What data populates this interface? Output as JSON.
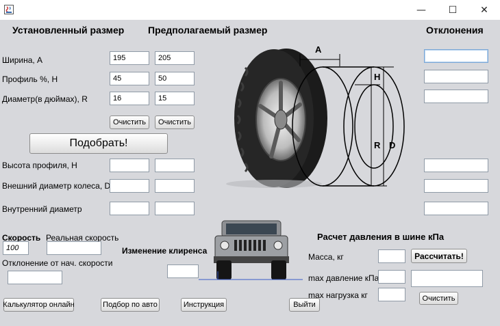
{
  "window": {
    "minimize_symbol": "—",
    "maximize_symbol": "☐",
    "close_symbol": "✕"
  },
  "headers": {
    "installed_size": "Установленный размер",
    "proposed_size": "Предполагаемый размер",
    "deviations": "Отклонения"
  },
  "labels": {
    "width": "Ширина,  А",
    "profile": "Профиль %, Н",
    "diameter": "Диаметр(в дюймах), R",
    "profile_height": "Высота профиля, Н",
    "outer_diameter": "Внешний диаметр колеса, D",
    "inner_diameter": "Внутренний диаметр",
    "speed": "Скорость",
    "real_speed": "Реальная скорость",
    "speed_deviation": "Отклонение от нач. скорости",
    "clearance_change": "Изменение клиренса",
    "pressure_title": "Расчет давления в шине кПа",
    "mass": "Масса, кг",
    "max_pressure": "max  давление кПа",
    "max_load": "max нагрузка кг"
  },
  "installed": {
    "width": "195",
    "profile": "45",
    "diameter": "16"
  },
  "proposed": {
    "width": "205",
    "profile": "50",
    "diameter": "15"
  },
  "speed_value": "100",
  "buttons": {
    "clear_installed": "Очистить",
    "clear_proposed": "Очистить",
    "pick": "Подобрать!",
    "calculate": "Рассчитать!",
    "clear_pressure": "Очистить",
    "calculator_online": "Калькулятор онлайн",
    "pick_by_car": "Подбор по авто",
    "instruction": "Инструкция",
    "exit": "Выйти"
  },
  "diagram": {
    "a": "A",
    "h": "H",
    "r": "R",
    "d": "D"
  },
  "icons": {
    "app": "java-app-icon",
    "tire": "tire-image",
    "car": "suv-car-image"
  }
}
